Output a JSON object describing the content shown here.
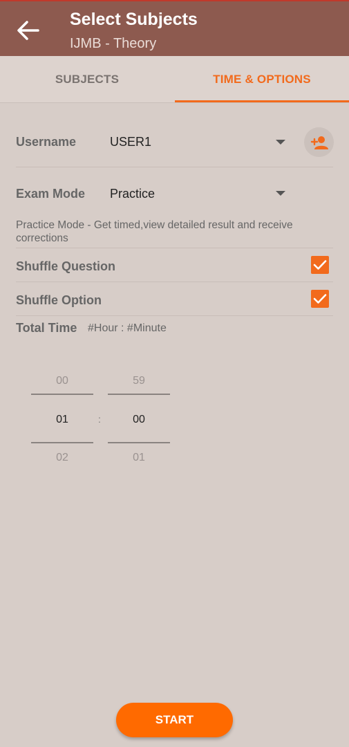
{
  "appbar": {
    "title": "Select Subjects",
    "subtitle": "IJMB - Theory",
    "back_icon": "arrow-left-icon",
    "background": "#8d5a4f"
  },
  "tabs": [
    {
      "label": "SUBJECTS",
      "active": false
    },
    {
      "label": "TIME & OPTIONS",
      "active": true
    }
  ],
  "accent_color": "#f26a1c",
  "username": {
    "label": "Username",
    "value": "USER1",
    "add_icon": "add-user-icon"
  },
  "exam_mode": {
    "label": "Exam Mode",
    "value": "Practice",
    "description": "Practice Mode - Get timed,view detailed result and receive corrections"
  },
  "options": {
    "shuffle_question": {
      "label": "Shuffle Question",
      "checked": true
    },
    "shuffle_option": {
      "label": "Shuffle Option",
      "checked": true
    }
  },
  "total_time": {
    "label": "Total Time",
    "format": "#Hour : #Minute",
    "hour": {
      "prev": "00",
      "selected": "01",
      "next": "02"
    },
    "minute": {
      "prev": "59",
      "selected": "00",
      "next": "01"
    },
    "separator": ":"
  },
  "start_button": {
    "label": "START",
    "color": "#ff6a00"
  }
}
